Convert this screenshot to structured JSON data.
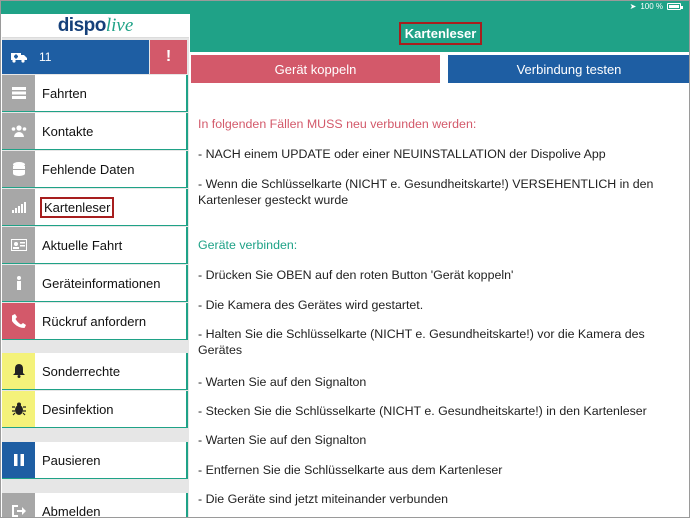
{
  "status_bar": {
    "battery_text": "100 %"
  },
  "sidebar": {
    "logo": {
      "part1": "dispo",
      "part2": "live"
    },
    "vehicle_number": "11",
    "alert_label": "!",
    "items": [
      {
        "label": "Fahrten",
        "icon": "list-icon"
      },
      {
        "label": "Kontakte",
        "icon": "contacts-icon"
      },
      {
        "label": "Fehlende Daten",
        "icon": "database-icon"
      },
      {
        "label": "Kartenleser",
        "icon": "signal-icon"
      },
      {
        "label": "Aktuelle Fahrt",
        "icon": "id-card-icon"
      },
      {
        "label": "Geräteinformationen",
        "icon": "info-icon"
      },
      {
        "label": "Rückruf anfordern",
        "icon": "phone-icon"
      },
      {
        "label": "Sonderrechte",
        "icon": "bell-icon"
      },
      {
        "label": "Desinfektion",
        "icon": "bug-icon"
      },
      {
        "label": "Pausieren",
        "icon": "pause-icon"
      },
      {
        "label": "Abmelden",
        "icon": "logout-icon"
      }
    ]
  },
  "header": {
    "title": "Kartenleser"
  },
  "actions": {
    "couple_label": "Gerät koppeln",
    "test_label": "Verbindung testen"
  },
  "content": {
    "reconnect_heading": "In folgenden Fällen MUSS neu verbunden werden:",
    "reconnect_items": [
      "- NACH einem UPDATE oder einer NEUINSTALLATION der Dispolive App",
      "- Wenn die Schlüsselkarte (NICHT e. Gesundheitskarte!) VERSEHENTLICH in den Kartenleser gesteckt wurde"
    ],
    "connect_heading": "Geräte verbinden:",
    "connect_steps": [
      "- Drücken Sie OBEN auf den roten Button 'Gerät koppeln'",
      "- Die Kamera des Gerätes wird gestartet.",
      "- Halten Sie die Schlüsselkarte (NICHT e. Gesundheitskarte!) vor die Kamera des Gerätes",
      "- Warten Sie auf den Signalton",
      "- Stecken Sie die Schlüsselkarte (NICHT e. Gesundheitskarte!) in den Kartenleser",
      "- Warten Sie auf den Signalton",
      "- Entfernen Sie die Schlüsselkarte aus dem Kartenleser",
      "- Die Geräte sind jetzt miteinander verbunden"
    ]
  },
  "colors": {
    "teal": "#1fa287",
    "navy": "#1e5ea3",
    "rose": "#d3596a",
    "yellow": "#f4f27a",
    "highlight": "#a71e1e"
  }
}
